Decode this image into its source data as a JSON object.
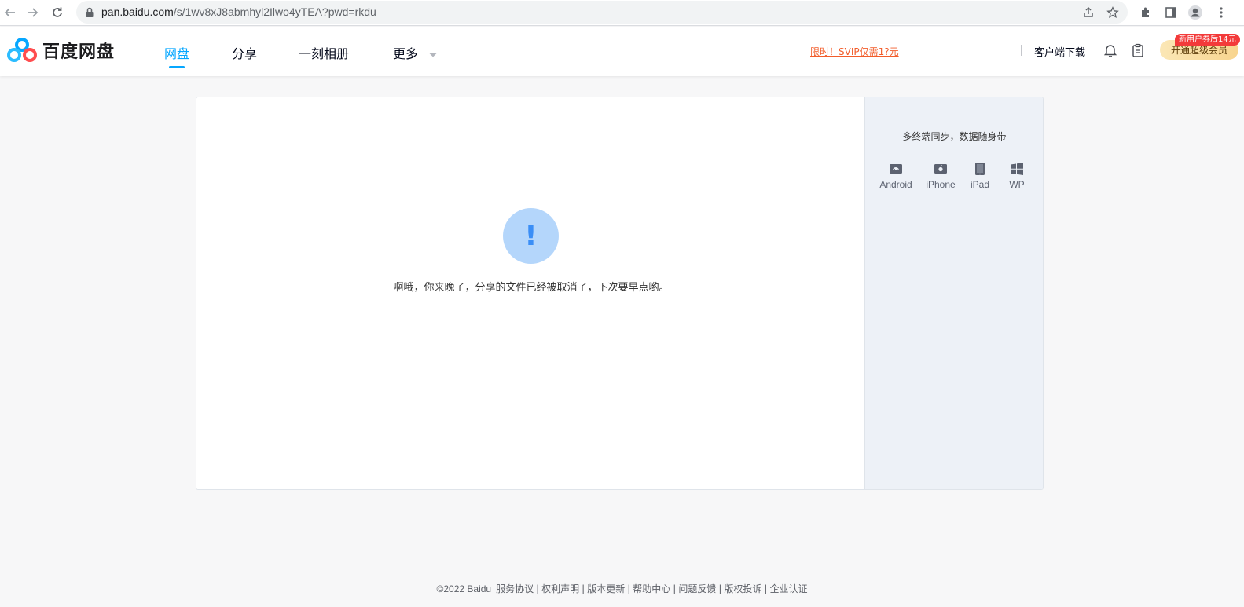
{
  "browser": {
    "url_host": "pan.baidu.com",
    "url_path": "/s/1wv8xJ8abmhyl2Ilwo4yTEA?pwd=rkdu"
  },
  "header": {
    "logo_text": "百度网盘",
    "nav": [
      {
        "label": "网盘",
        "active": true
      },
      {
        "label": "分享",
        "active": false
      },
      {
        "label": "一刻相册",
        "active": false
      },
      {
        "label": "更多",
        "active": false
      }
    ],
    "promo": "限时！SVIP仅需1?元",
    "client_download": "客户端下载",
    "vip_button": "开通超级会员",
    "vip_badge": "新用户券后14元"
  },
  "main": {
    "message": "啊哦，你来晚了，分享的文件已经被取消了，下次要早点哟。",
    "side_title": "多终端同步，数据随身带",
    "platforms": [
      {
        "label": "Android",
        "icon": "android-icon"
      },
      {
        "label": "iPhone",
        "icon": "iphone-icon"
      },
      {
        "label": "iPad",
        "icon": "ipad-icon"
      },
      {
        "label": "WP",
        "icon": "windows-icon"
      }
    ]
  },
  "footer": {
    "copyright": "©2022 Baidu",
    "links": [
      "服务协议",
      "权利声明",
      "版本更新",
      "帮助中心",
      "问题反馈",
      "版权投诉",
      "企业认证"
    ]
  },
  "colors": {
    "brand": "#06a7ff",
    "promo": "#f25d2b",
    "warning_bg": "#b4d6fb",
    "warning_fg": "#3a8ef6"
  }
}
